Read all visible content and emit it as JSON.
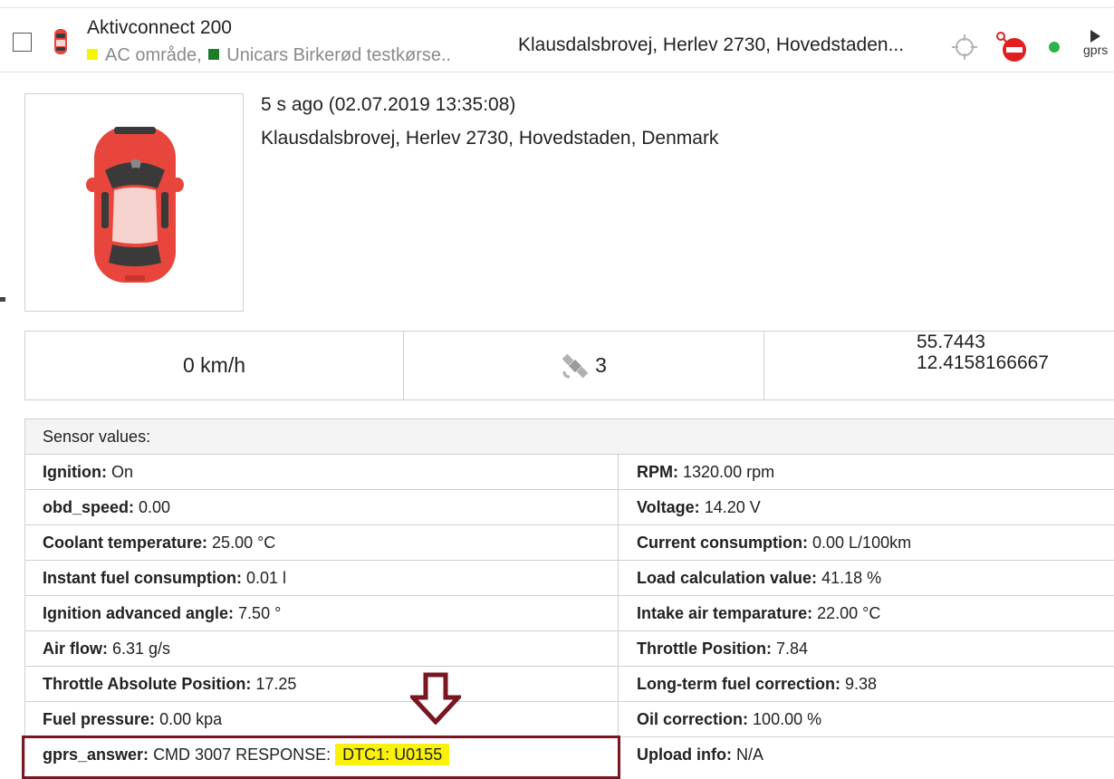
{
  "device": {
    "name": "Aktivconnect 200",
    "group1": "AC område,",
    "group2": "Unicars Birkerød testkørse..",
    "address_short": "Klausdalsbrovej, Herlev 2730, Hovedstaden...",
    "gprs_label": "gprs",
    "colors": {
      "group1": "#f7f400",
      "group2": "#1d7d2a",
      "online": "#2bb34a",
      "car": "#e8463c"
    }
  },
  "detail": {
    "time_ago": "5 s ago (02.07.2019 13:35:08)",
    "address": "Klausdalsbrovej, Herlev 2730, Hovedstaden, Denmark"
  },
  "stats": {
    "speed": "0 km/h",
    "satellites": "3",
    "lat": "55.7443",
    "lng": "12.4158166667"
  },
  "sensors": {
    "title": "Sensor values:",
    "rows": [
      {
        "l_label": "Ignition:",
        "l_value": "On",
        "r_label": "RPM:",
        "r_value": "1320.00 rpm"
      },
      {
        "l_label": "obd_speed:",
        "l_value": "0.00",
        "r_label": "Voltage:",
        "r_value": "14.20 V"
      },
      {
        "l_label": "Coolant temperature:",
        "l_value": "25.00 °C",
        "r_label": "Current consumption:",
        "r_value": "0.00 L/100km"
      },
      {
        "l_label": "Instant fuel consumption:",
        "l_value": "0.01 l",
        "r_label": "Load calculation value:",
        "r_value": "41.18 %"
      },
      {
        "l_label": "Ignition advanced angle:",
        "l_value": "7.50 °",
        "r_label": "Intake air temparature:",
        "r_value": "22.00 °C"
      },
      {
        "l_label": "Air flow:",
        "l_value": "6.31 g/s",
        "r_label": "Throttle Position:",
        "r_value": "7.84"
      },
      {
        "l_label": "Throttle Absolute Position:",
        "l_value": "17.25",
        "r_label": "Long-term fuel correction:",
        "r_value": "9.38"
      },
      {
        "l_label": "Fuel pressure:",
        "l_value": "0.00 kpa",
        "r_label": "Oil correction:",
        "r_value": "100.00 %"
      }
    ],
    "gprs_row": {
      "label": "gprs_answer:",
      "value": "CMD 3007 RESPONSE:",
      "highlight": "DTC1: U0155",
      "r_label": "Upload info:",
      "r_value": "N/A"
    }
  },
  "icons": [
    "car-icon",
    "target-icon",
    "alarm-off-icon",
    "play-icon",
    "satellite-icon",
    "arrow-down-icon"
  ]
}
